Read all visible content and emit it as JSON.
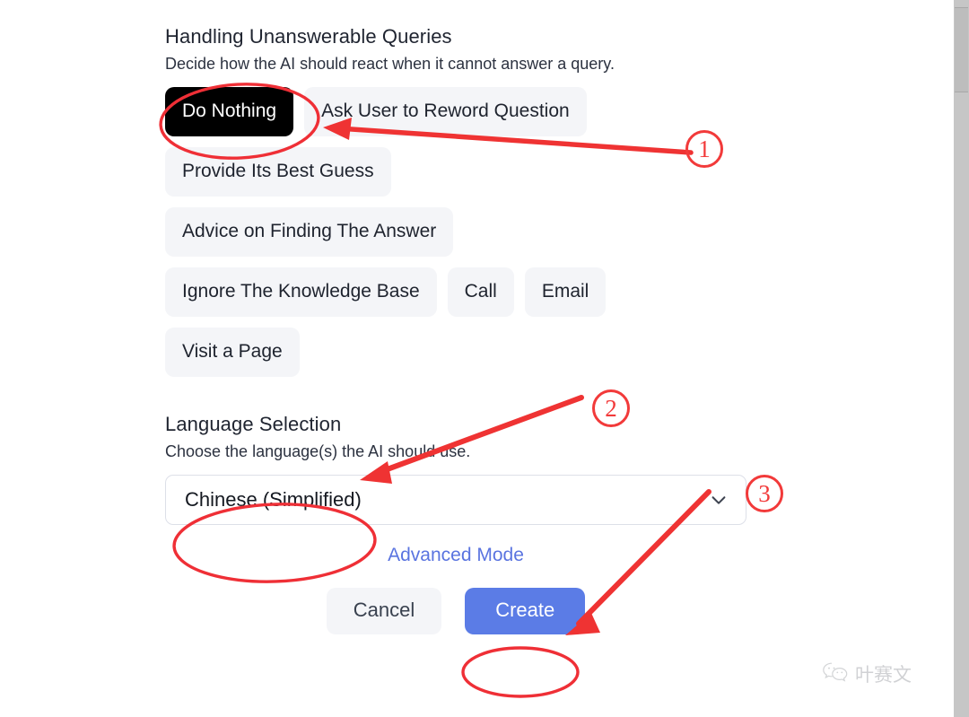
{
  "unanswerable": {
    "title": "Handling Unanswerable Queries",
    "subtitle": "Decide how the AI should react when it cannot answer a query.",
    "options": [
      {
        "label": "Do Nothing",
        "selected": true
      },
      {
        "label": "Ask User to Reword Question",
        "selected": false
      },
      {
        "label": "Provide Its Best Guess",
        "selected": false
      },
      {
        "label": "Advice on Finding The Answer",
        "selected": false
      },
      {
        "label": "Ignore The Knowledge Base",
        "selected": false
      },
      {
        "label": "Call",
        "selected": false
      },
      {
        "label": "Email",
        "selected": false
      },
      {
        "label": "Visit a Page",
        "selected": false
      }
    ]
  },
  "language": {
    "title": "Language Selection",
    "subtitle": "Choose the language(s) the AI should use.",
    "selected_value": "Chinese (Simplified)",
    "chevron_icon": "chevron-down-icon"
  },
  "footer": {
    "advanced_link": "Advanced Mode",
    "cancel_label": "Cancel",
    "create_label": "Create"
  },
  "annotations": {
    "markers": [
      {
        "id": "1",
        "glyph": "1"
      },
      {
        "id": "2",
        "glyph": "2"
      },
      {
        "id": "3",
        "glyph": "3"
      }
    ],
    "color": "#f23a3a",
    "highlight_targets": [
      "Do Nothing",
      "Chinese (Simplified)",
      "Create"
    ]
  },
  "watermark": {
    "icon": "wechat-icon",
    "text": "叶赛文"
  },
  "colors": {
    "chip_bg": "#f4f5f8",
    "chip_selected_bg": "#000000",
    "primary_button": "#5b7ce6",
    "link": "#5a74e0",
    "annotation_red": "#f23a3a"
  }
}
